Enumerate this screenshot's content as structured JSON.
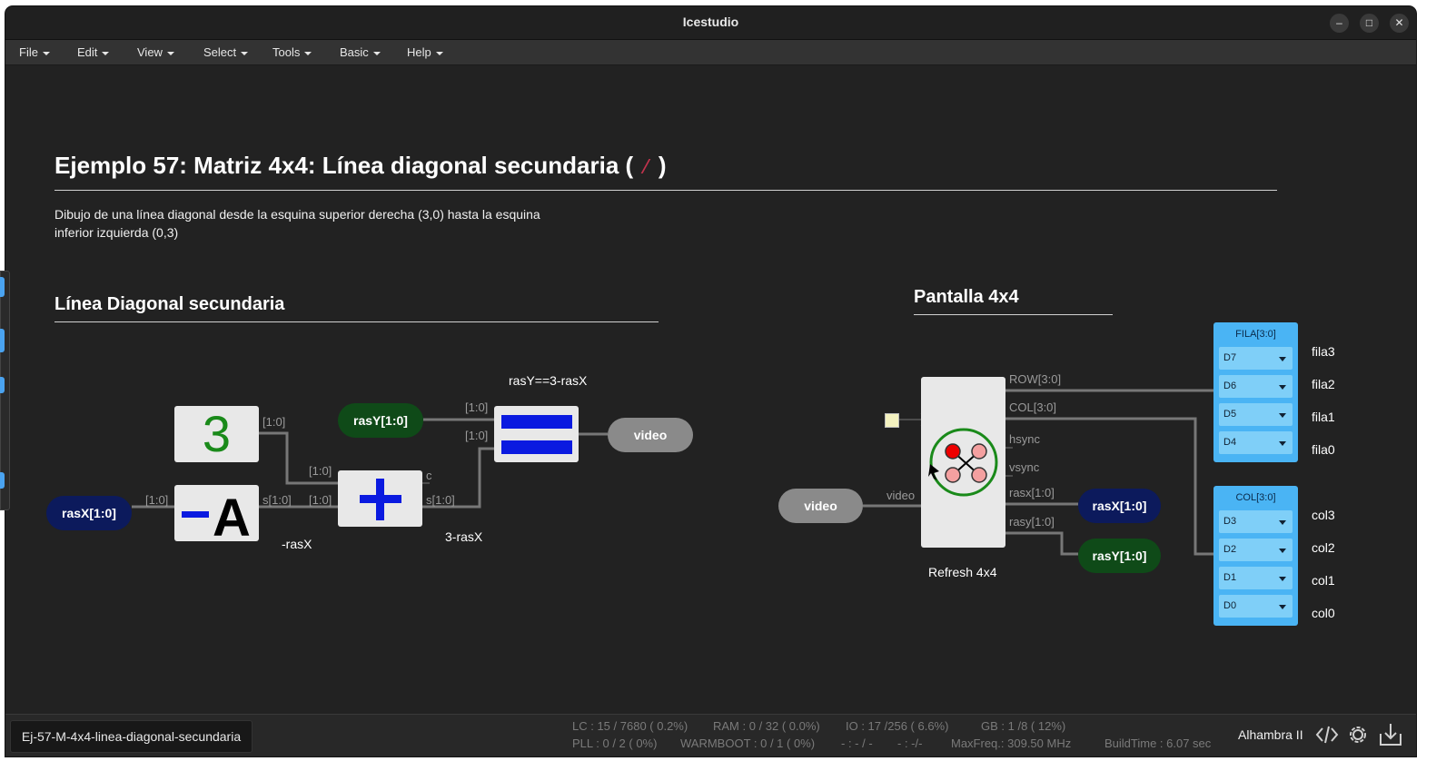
{
  "window": {
    "title": "Icestudio"
  },
  "menu": [
    "File",
    "Edit",
    "View",
    "Select",
    "Tools",
    "Basic",
    "Help"
  ],
  "doc": {
    "title_prefix": "Ejemplo 57: Matriz 4x4: Línea diagonal secundaria (",
    "title_slash": "/",
    "title_suffix": ")",
    "desc_line1": "Dibujo de una línea diagonal desde la esquina superior derecha (3,0) hasta la esquina",
    "desc_line2": "inferior izquierda (0,3)"
  },
  "left_section": {
    "title": "Línea Diagonal secundaria",
    "const_value": "3",
    "rasX": "rasX[1:0]",
    "rasY": "rasY[1:0]",
    "video": "video",
    "eq_label": "rasY==3-rasX",
    "neg_label": "-rasX",
    "sum_label": "3-rasX",
    "ports": {
      "const_out": "[1:0]",
      "neg_in": "[1:0]",
      "neg_out": "s[1:0]",
      "add_in_a": "[1:0]",
      "add_in_b": "[1:0]",
      "add_c": "c",
      "add_s": "s[1:0]",
      "eq_in_a": "[1:0]",
      "eq_in_b": "[1:0]"
    }
  },
  "right_section": {
    "title": "Pantalla 4x4",
    "video_in": "video",
    "video_port": "video",
    "refresh_label": "Refresh 4x4",
    "outputs": [
      "ROW[3:0]",
      "COL[3:0]",
      "hsync",
      "vsync",
      "rasx[1:0]",
      "rasy[1:0]"
    ],
    "rasX": "rasX[1:0]",
    "rasY": "rasY[1:0]",
    "fila_panel": {
      "header": "FILA[3:0]",
      "pins": [
        "D7",
        "D6",
        "D5",
        "D4"
      ],
      "labels": [
        "fila3",
        "fila2",
        "fila1",
        "fila0"
      ]
    },
    "col_panel": {
      "header": "COL[3:0]",
      "pins": [
        "D3",
        "D2",
        "D1",
        "D0"
      ],
      "labels": [
        "col3",
        "col2",
        "col1",
        "col0"
      ]
    }
  },
  "status": {
    "filename": "Ej-57-M-4x4-linea-diagonal-secundaria",
    "lc": "LC : 15 / 7680 ( 0.2%)",
    "ram": "RAM : 0 / 32 ( 0.0%)",
    "io": "IO :  17 /256  ( 6.6%)",
    "gb": "GB :  1 /8  ( 12%)",
    "pll": "PLL : 0 / 2 ( 0%)",
    "warmboot": "WARMBOOT : 0 / 1 ( 0%)",
    "dash1": "- : - / -",
    "dash2": "- : -/-",
    "maxfreq": "MaxFreq.:  309.50 MHz",
    "buildtime": "BuildTime :  6.07 sec",
    "board": "Alhambra II"
  },
  "colors": {
    "background": "#222222",
    "wire": "#777777",
    "navy_pill": "#0c1a5c",
    "green_pill": "#0f4a18",
    "panel_blue": "#4ab4f4",
    "operator_blue": "#0a1ae0",
    "const_green": "#1a8a1a"
  }
}
